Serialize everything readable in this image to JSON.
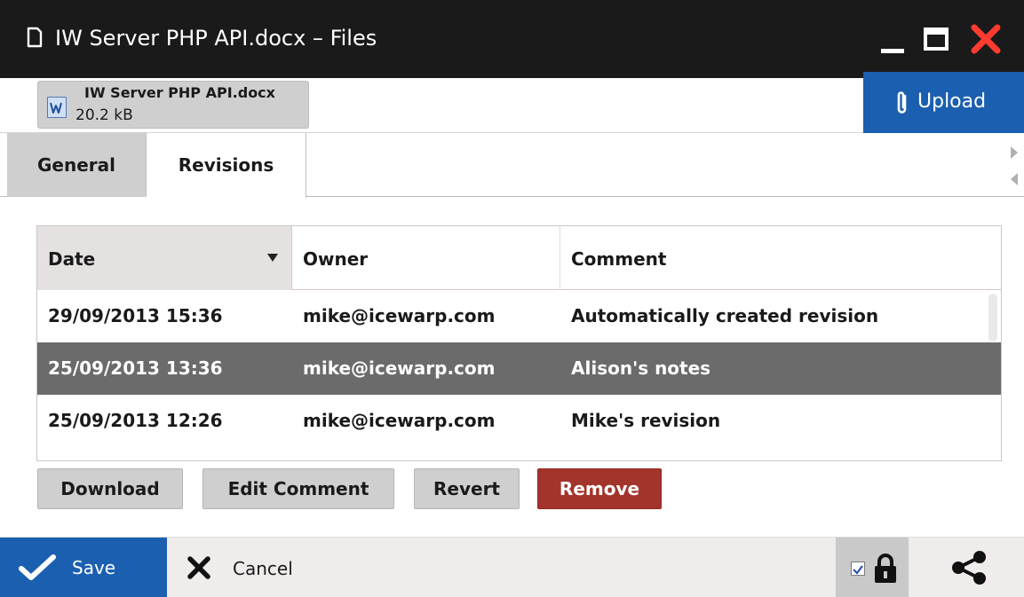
{
  "window": {
    "title": "IW Server PHP API.docx – Files",
    "icons": {
      "document": "document-icon",
      "minimize": "minimize-icon",
      "maximize": "maximize-icon",
      "close": "close-icon"
    },
    "close_color": "#ff3b30"
  },
  "file": {
    "name": "IW Server PHP API.docx",
    "size": "20.2 kB",
    "icon": "word-document-icon"
  },
  "upload": {
    "label": "Upload",
    "icon": "paperclip-icon",
    "color": "#1b5fb0"
  },
  "tabs": [
    {
      "label": "General",
      "active": false
    },
    {
      "label": "Revisions",
      "active": true
    }
  ],
  "revisions": {
    "columns": {
      "date": "Date",
      "owner": "Owner",
      "comment": "Comment"
    },
    "sort": {
      "column": "Date",
      "direction": "descending"
    },
    "rows": [
      {
        "date": "29/09/2013 15:36",
        "owner": "mike@icewarp.com",
        "comment": "Automatically created revision",
        "selected": false
      },
      {
        "date": "25/09/2013 13:36",
        "owner": "mike@icewarp.com",
        "comment": "Alison's notes",
        "selected": true
      },
      {
        "date": "25/09/2013 12:26",
        "owner": "mike@icewarp.com",
        "comment": "Mike's revision",
        "selected": false
      }
    ]
  },
  "actions": {
    "download": "Download",
    "edit_comment": "Edit Comment",
    "revert": "Revert",
    "remove": "Remove",
    "remove_color": "#a3342b"
  },
  "footer": {
    "save": "Save",
    "cancel": "Cancel",
    "lock_checked": true,
    "icons": {
      "save": "checkmark-icon",
      "cancel": "x-icon",
      "lock": "lock-icon",
      "share": "share-icon"
    }
  }
}
